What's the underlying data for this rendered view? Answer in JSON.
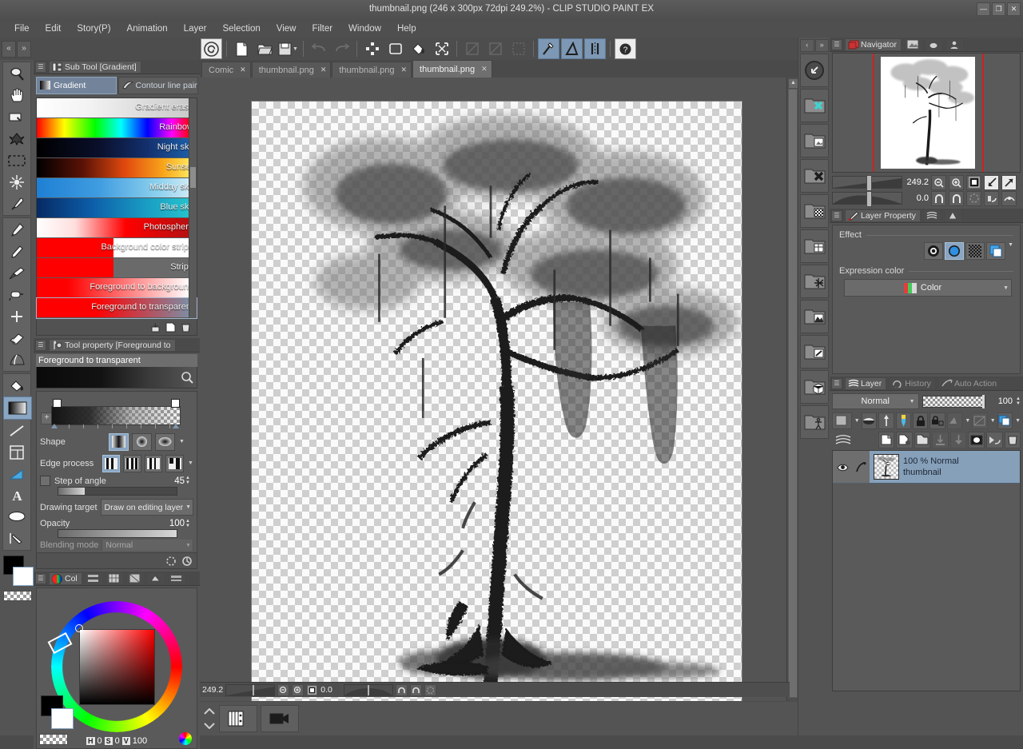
{
  "window": {
    "title": "thumbnail.png (246 x 300px 72dpi 249.2%)  - CLIP STUDIO PAINT EX",
    "minimize": "—",
    "maximize": "❐",
    "close": "✕"
  },
  "menubar": {
    "items": [
      "File",
      "Edit",
      "Story(P)",
      "Animation",
      "Layer",
      "Selection",
      "View",
      "Filter",
      "Window",
      "Help"
    ]
  },
  "command_bar": {
    "nav_prev": "«",
    "nav_next": "»",
    "buttons": [
      {
        "name": "clip-studio-logo-icon",
        "label": "CLIP STUDIO"
      },
      {
        "name": "new-file-icon",
        "label": "New"
      },
      {
        "name": "open-file-icon",
        "label": "Open"
      },
      {
        "name": "save-icon",
        "label": "Save"
      },
      {
        "name": "undo-icon",
        "label": "Undo"
      },
      {
        "name": "redo-icon",
        "label": "Redo"
      },
      {
        "name": "deselect-icon",
        "label": "Deselect"
      },
      {
        "name": "select-all-icon",
        "label": "Select All"
      },
      {
        "name": "fill-icon",
        "label": "Fill"
      },
      {
        "name": "transform-icon",
        "label": "Transform"
      },
      {
        "name": "ruler-snap-off-icon",
        "label": "Snap to special ruler"
      },
      {
        "name": "grid-snap-icon",
        "label": "Snap to grid"
      },
      {
        "name": "selection-snap-icon",
        "label": "Snap to selection"
      },
      {
        "name": "guide-ruler-icon",
        "label": "Ruler"
      },
      {
        "name": "perspective-icon",
        "label": "Perspective ruler"
      },
      {
        "name": "symmetry-icon",
        "label": "Symmetrical ruler"
      },
      {
        "name": "help-icon",
        "label": "Help"
      }
    ]
  },
  "tools": {
    "group1": [
      {
        "name": "magnifier-tool",
        "label": "Zoom"
      },
      {
        "name": "hand-tool",
        "label": "Move"
      },
      {
        "name": "rotate-tool",
        "label": "Rotate"
      },
      {
        "name": "object-tool",
        "label": "Operation"
      },
      {
        "name": "marquee-tool",
        "label": "Selection area"
      },
      {
        "name": "auto-select-tool",
        "label": "Auto select"
      },
      {
        "name": "eyedropper-tool",
        "label": "Eyedropper"
      }
    ],
    "group2": [
      {
        "name": "pen-tool",
        "label": "Pen"
      },
      {
        "name": "pencil-tool",
        "label": "Pencil"
      },
      {
        "name": "brush-tool",
        "label": "Brush"
      },
      {
        "name": "airbrush-tool",
        "label": "Airbrush"
      },
      {
        "name": "decoration-tool",
        "label": "Decoration"
      },
      {
        "name": "eraser-tool",
        "label": "Eraser"
      },
      {
        "name": "blend-tool",
        "label": "Blend"
      }
    ],
    "group3": [
      {
        "name": "fill-tool",
        "label": "Fill"
      },
      {
        "name": "gradient-tool",
        "label": "Gradient",
        "active": true
      },
      {
        "name": "figure-tool",
        "label": "Figure"
      },
      {
        "name": "frame-border-tool",
        "label": "Frame border"
      },
      {
        "name": "ruler-tool",
        "label": "Ruler"
      },
      {
        "name": "text-tool",
        "label": "Text"
      },
      {
        "name": "balloon-tool",
        "label": "Balloon"
      },
      {
        "name": "correct-line-tool",
        "label": "Correct line"
      }
    ],
    "color_chip": {
      "foreground": "#000000",
      "background": "#ffffff",
      "transparent": "transparent"
    }
  },
  "sub_tool_palette": {
    "title": "Sub Tool [Gradient]",
    "tabs": [
      {
        "name": "gradient",
        "label": "Gradient",
        "selected": true
      },
      {
        "name": "contour-line-paint",
        "label": "Contour line paint",
        "selected": false
      }
    ],
    "presets": [
      {
        "label": "Foreground to transparent",
        "selected": true,
        "swatch_css": "linear-gradient(90deg,#ff0000 0%,#ff0000 38%,rgba(255,0,0,0) 100%)",
        "swatch_w": 192
      },
      {
        "label": "Foreground to background",
        "selected": false,
        "swatch_css": "linear-gradient(90deg,#ff0000 0%,#ff0000 20%,#ffffff 100%)",
        "swatch_w": 192
      },
      {
        "label": "Stripe",
        "selected": false,
        "swatch_css": "linear-gradient(90deg,#ff0000,#ff0000)",
        "swatch_w": 96
      },
      {
        "label": "Background color stripe",
        "selected": false,
        "swatch_css": "linear-gradient(90deg,#ff0000 0%,#ff0000 50%,#ffffff 50%,#ffffff 100%)",
        "swatch_w": 192
      },
      {
        "label": "Photosphere",
        "selected": false,
        "swatch_css": "linear-gradient(90deg,#ffffff 0%,#ffdede 25%,#ff0000 58%,#b41212 100%)",
        "swatch_w": 192
      },
      {
        "label": "Blue sky",
        "selected": false,
        "swatch_css": "linear-gradient(90deg,#062a63 0%,#0c5ca8 35%,#1a9ec4 72%,#27c2cc 100%)",
        "swatch_w": 192
      },
      {
        "label": "Midday sky",
        "selected": false,
        "swatch_css": "linear-gradient(90deg,#1e7fd4 0%,#3f9ce0 40%,#8fd2ee 80%,#cfeaf6 100%)",
        "swatch_w": 192
      },
      {
        "label": "Sunset",
        "selected": false,
        "swatch_css": "linear-gradient(90deg,#000000 0%,#5a1206 30%,#e24a0e 58%,#f7a41a 82%,#ffe65c 100%)",
        "swatch_w": 192
      },
      {
        "label": "Night sky",
        "selected": false,
        "swatch_css": "linear-gradient(90deg,#000000 0%,#0a0f2a 40%,#13306e 72%,#1d5ea8 100%)",
        "swatch_w": 192
      },
      {
        "label": "Rainbow",
        "selected": false,
        "swatch_css": "linear-gradient(90deg,#ff0000,#ffff00 18%,#00ff00 38%,#00ffff 55%,#0000ff 72%,#ff00ff 88%,#ff0000)",
        "swatch_w": 192
      },
      {
        "label": "Gradient erase",
        "selected": false,
        "swatch_css": "linear-gradient(90deg,#ffffff 0%,#f2f2f2 35%,#c9c9c9 100%)",
        "swatch_w": 192
      }
    ],
    "footer_buttons": [
      {
        "name": "import-sub-tool-icon",
        "label": "Import"
      },
      {
        "name": "create-new-sub-tool-icon",
        "label": "Create new setting"
      },
      {
        "name": "delete-sub-tool-icon",
        "label": "Delete"
      }
    ]
  },
  "tool_property": {
    "title": "Tool property [Foreground to ",
    "preset_name": "Foreground to transparent",
    "magnify_icon": "magnify-icon",
    "shape": {
      "label": "Shape",
      "options": [
        "linear",
        "circle",
        "ellipse"
      ],
      "selected": 0
    },
    "edge_process": {
      "label": "Edge process",
      "options": [
        "repeat",
        "reflect",
        "none",
        "clip"
      ],
      "selected": 0
    },
    "step_of_angle": {
      "label": "Step of angle",
      "checked": false,
      "value": "45",
      "slider_pct": 22
    },
    "drawing_target": {
      "label": "Drawing target",
      "value": "Draw on editing layer"
    },
    "opacity": {
      "label": "Opacity",
      "value": "100",
      "slider_pct": 100
    },
    "blending_mode": {
      "label": "Blending mode",
      "value": "Normal"
    }
  },
  "color_palette": {
    "title": "Col",
    "tabs": [
      "color-wheel-icon",
      "color-slider-icon",
      "color-set-icon",
      "intermediate-color-icon",
      "approximate-color-icon",
      "gradient-color-icon"
    ],
    "h_key": "H",
    "h_value": "0",
    "s_key": "S",
    "s_value": "0",
    "v_key": "V",
    "v_value": "100"
  },
  "document_tabs": [
    {
      "label": "Comic",
      "active": false,
      "close": "✕"
    },
    {
      "label": "thumbnail.png",
      "active": false,
      "close": "✕"
    },
    {
      "label": "thumbnail.png",
      "active": false,
      "close": "✕"
    },
    {
      "label": "thumbnail.png",
      "active": true,
      "close": "✕"
    }
  ],
  "canvas_status": {
    "zoom": "249.2",
    "rotation": "0.0",
    "zoom_out_icon": "zoom-out-icon",
    "zoom_in_icon": "zoom-in-icon",
    "fit_icon": "fit-to-screen-icon",
    "rotate_left_icon": "rotate-left-icon",
    "rotate_right_icon": "rotate-right-icon",
    "reset_rotation_icon": "reset-rotation-icon"
  },
  "animation_bar": {
    "buttons": [
      {
        "name": "timeline-icon",
        "label": "Timeline"
      },
      {
        "name": "animation-cels-icon",
        "label": "Animation cels"
      }
    ]
  },
  "right_icon_bar": {
    "nav_prev": "‹",
    "nav_next": "»",
    "buttons": [
      {
        "name": "quick-access-icon",
        "label": "Quick Access"
      },
      {
        "name": "material-close-icon",
        "label": "Material"
      },
      {
        "name": "material-image-icon",
        "label": "Image material"
      },
      {
        "name": "material-delete-icon",
        "label": "Delete material"
      },
      {
        "name": "material-monochrome-icon",
        "label": "Monochromatic pattern"
      },
      {
        "name": "material-manga-icon",
        "label": "Manga material"
      },
      {
        "name": "material-effect-icon",
        "label": "Effect line"
      },
      {
        "name": "material-scene-icon",
        "label": "Background material"
      },
      {
        "name": "material-color-icon",
        "label": "Color pattern"
      },
      {
        "name": "material-3d-icon",
        "label": "3D material"
      },
      {
        "name": "material-pose-icon",
        "label": "3D pose"
      }
    ]
  },
  "navigator": {
    "title": "Navigator",
    "tabs": [
      "navigator-icon",
      "sub-view-icon",
      "item-bank-icon",
      "information-icon"
    ],
    "zoom": "249.2",
    "rotation": "0.0",
    "buttons": [
      {
        "name": "zoom-out-icon",
        "label": "Zoom out"
      },
      {
        "name": "zoom-in-icon",
        "label": "Zoom in"
      },
      {
        "name": "fit-to-screen-icon",
        "label": "Fit to screen"
      },
      {
        "name": "flip-horizontal-icon",
        "label": "Flip horizontal"
      },
      {
        "name": "flip-vertical-icon",
        "label": "Flip vertical"
      },
      {
        "name": "rotate-left-icon",
        "label": "Rotate left"
      },
      {
        "name": "rotate-right-icon",
        "label": "Rotate right"
      },
      {
        "name": "reset-rotation-icon",
        "label": "Reset rotation"
      },
      {
        "name": "quick-mask-icon",
        "label": "Quick mask"
      },
      {
        "name": "preview-icon",
        "label": "Preview"
      }
    ]
  },
  "layer_property": {
    "title": "Layer Property",
    "tabs": [
      "layer-property-icon",
      "animation-folder-icon",
      "tone-icon"
    ],
    "effect_label": "Effect",
    "effect_buttons": [
      {
        "name": "border-effect-icon",
        "label": "Border effect",
        "selected": false
      },
      {
        "name": "tone-effect-icon",
        "label": "Tone",
        "selected": true
      },
      {
        "name": "halftone-effect-icon",
        "label": "Halftone",
        "selected": false
      },
      {
        "name": "layer-color-icon",
        "label": "Layer color",
        "selected": false
      }
    ],
    "expression_color_label": "Expression color",
    "expression_color_value": "Color"
  },
  "layer_palette": {
    "tabs": [
      {
        "name": "layer-tab",
        "label": "Layer",
        "selected": true
      },
      {
        "name": "history-tab",
        "label": "History",
        "selected": false
      },
      {
        "name": "auto-action-tab",
        "label": "Auto Action",
        "selected": false
      }
    ],
    "blend_mode": "Normal",
    "opacity": "100",
    "toolbar_row1": [
      {
        "name": "palette-color-icon",
        "label": "Palette color"
      },
      {
        "name": "clip-to-layer-below-icon",
        "label": "Clip at layer below"
      },
      {
        "name": "set-as-reference-layer-icon",
        "label": "Set as reference layer"
      },
      {
        "name": "set-as-draft-layer-icon",
        "label": "Set as draft layer"
      },
      {
        "name": "lock-layer-icon",
        "label": "Lock layer"
      },
      {
        "name": "lock-transparent-pixels-icon",
        "label": "Lock transparent pixel"
      },
      {
        "name": "ruler-visible-icon",
        "label": "Show ruler in all layers"
      },
      {
        "name": "effect-visible-icon",
        "label": "Show effect in all layers"
      },
      {
        "name": "layer-color-toggle-icon",
        "label": "Layer color"
      }
    ],
    "toolbar_row2": [
      {
        "name": "new-raster-layer-icon",
        "label": "New raster layer"
      },
      {
        "name": "new-layer-with-icon",
        "label": "New layer"
      },
      {
        "name": "new-layer-folder-icon",
        "label": "New layer folder"
      },
      {
        "name": "transfer-down-icon",
        "label": "Transfer to lower layer"
      },
      {
        "name": "combine-down-icon",
        "label": "Combine to layer below"
      },
      {
        "name": "layer-mask-icon",
        "label": "Create layer mask"
      },
      {
        "name": "apply-mask-icon",
        "label": "Apply mask to layer"
      },
      {
        "name": "delete-layer-icon",
        "label": "Delete layer"
      }
    ],
    "layers": [
      {
        "blend": "100 % Normal",
        "name": "thumbnail",
        "visible": true,
        "selected": true
      }
    ]
  }
}
